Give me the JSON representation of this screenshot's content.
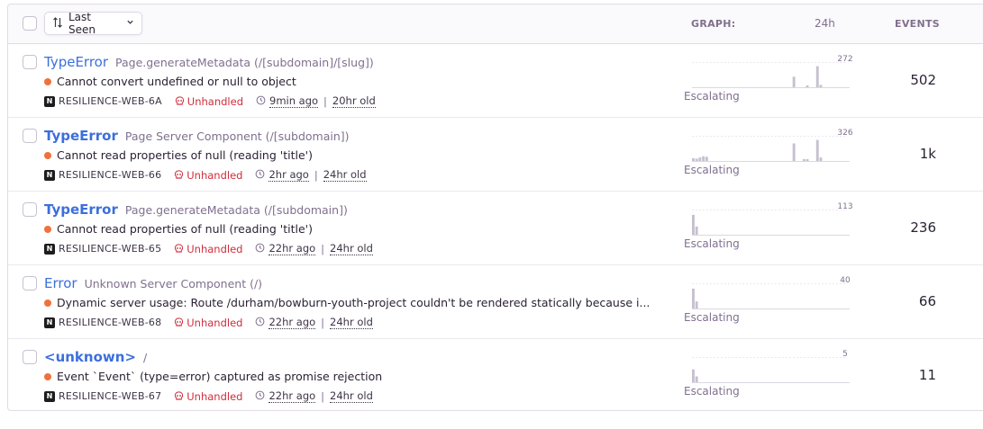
{
  "toolbar": {
    "sort_label": "Last Seen",
    "graph_label": "GRAPH:",
    "period_label": "24h",
    "events_label": "EVENTS"
  },
  "issues": [
    {
      "type": "TypeError",
      "bold": false,
      "location": "Page.generateMetadata (/[subdomain]/[slug])",
      "message": "Cannot convert undefined or null to object",
      "short_id": "RESILIENCE-WEB-6A",
      "handled": "Unhandled",
      "last_seen": "9min ago",
      "age": "20hr old",
      "graph_max_label": "272",
      "graph_status": "Escalating",
      "events": "502",
      "bars": [
        0,
        0,
        0,
        0,
        0,
        0,
        0,
        0,
        0,
        0,
        0,
        0,
        0,
        0,
        0,
        0,
        0,
        0,
        0,
        0,
        0,
        0,
        0,
        0,
        0,
        0,
        0,
        0,
        0,
        0,
        0.45,
        0,
        0,
        0,
        0.06,
        0,
        0,
        0.9,
        0.1,
        0,
        0,
        0,
        0,
        0,
        0,
        0,
        0
      ]
    },
    {
      "type": "TypeError",
      "bold": true,
      "location": "Page Server Component (/[subdomain])",
      "message": "Cannot read properties of null (reading 'title')",
      "short_id": "RESILIENCE-WEB-66",
      "handled": "Unhandled",
      "last_seen": "2hr ago",
      "age": "24hr old",
      "graph_max_label": "326",
      "graph_status": "Escalating",
      "events": "1k",
      "bars": [
        0.12,
        0.1,
        0.15,
        0.2,
        0.18,
        0,
        0,
        0,
        0,
        0,
        0,
        0,
        0,
        0,
        0,
        0,
        0,
        0,
        0,
        0,
        0,
        0,
        0,
        0,
        0,
        0,
        0,
        0,
        0,
        0,
        0.75,
        0,
        0,
        0.08,
        0.06,
        0,
        0,
        0.9,
        0.15,
        0,
        0,
        0,
        0,
        0,
        0,
        0,
        0
      ]
    },
    {
      "type": "TypeError",
      "bold": true,
      "location": "Page.generateMetadata (/[subdomain])",
      "message": "Cannot read properties of null (reading 'title')",
      "short_id": "RESILIENCE-WEB-65",
      "handled": "Unhandled",
      "last_seen": "22hr ago",
      "age": "24hr old",
      "graph_max_label": "113",
      "graph_status": "Escalating",
      "events": "236",
      "bars": [
        0.85,
        0.35,
        0,
        0,
        0,
        0,
        0,
        0,
        0,
        0,
        0,
        0,
        0,
        0,
        0,
        0,
        0,
        0,
        0,
        0,
        0,
        0,
        0,
        0,
        0,
        0,
        0,
        0,
        0,
        0,
        0,
        0,
        0,
        0,
        0,
        0,
        0,
        0,
        0,
        0,
        0,
        0,
        0,
        0,
        0,
        0,
        0
      ]
    },
    {
      "type": "Error",
      "bold": false,
      "location": "Unknown Server Component (/)",
      "message": "Dynamic server usage: Route /durham/bowburn-youth-project couldn't be rendered statically because i...",
      "short_id": "RESILIENCE-WEB-68",
      "handled": "Unhandled",
      "last_seen": "22hr ago",
      "age": "24hr old",
      "graph_max_label": "40",
      "graph_status": "Escalating",
      "events": "66",
      "bars": [
        0.85,
        0.3,
        0,
        0,
        0,
        0,
        0,
        0,
        0,
        0,
        0,
        0,
        0,
        0,
        0,
        0,
        0,
        0,
        0,
        0,
        0,
        0,
        0,
        0,
        0,
        0,
        0,
        0,
        0,
        0,
        0,
        0,
        0,
        0,
        0,
        0,
        0,
        0,
        0,
        0,
        0,
        0,
        0,
        0,
        0,
        0,
        0
      ]
    },
    {
      "type": "<unknown>",
      "bold": true,
      "location": "/",
      "message": "Event `Event` (type=error) captured as promise rejection",
      "short_id": "RESILIENCE-WEB-67",
      "handled": "Unhandled",
      "last_seen": "22hr ago",
      "age": "24hr old",
      "graph_max_label": "5",
      "graph_status": "Escalating",
      "events": "11",
      "bars": [
        0.55,
        0.25,
        0,
        0,
        0,
        0,
        0,
        0,
        0,
        0,
        0,
        0,
        0,
        0,
        0,
        0,
        0,
        0,
        0,
        0,
        0,
        0,
        0,
        0,
        0,
        0,
        0,
        0,
        0,
        0,
        0,
        0,
        0,
        0,
        0,
        0,
        0,
        0,
        0,
        0,
        0,
        0,
        0,
        0,
        0,
        0,
        0
      ]
    }
  ],
  "colors": {
    "link": "#3c6fdc",
    "unhandled": "#cf2d3c",
    "level_dot": "#f0713d",
    "bar": "#c6c0cf"
  }
}
